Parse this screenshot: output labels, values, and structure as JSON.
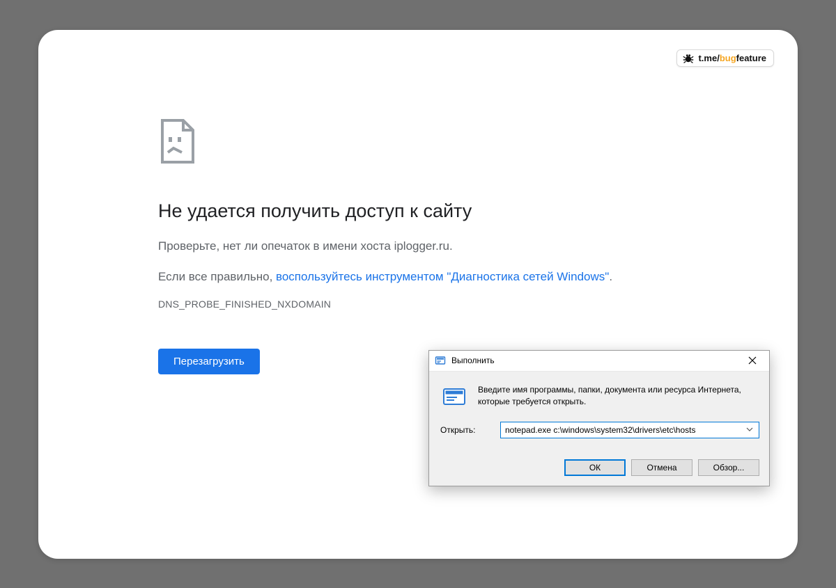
{
  "badge": {
    "prefix": "t.me/",
    "highlight": "bug",
    "suffix": "feature"
  },
  "error": {
    "title": "Не удается получить доступ к сайту",
    "line1": "Проверьте, нет ли опечаток в имени хоста iplogger.ru.",
    "line2_prefix": "Если все правильно, ",
    "line2_link": "воспользуйтесь инструментом \"Диагностика сетей Windows\"",
    "line2_suffix": ".",
    "code": "DNS_PROBE_FINISHED_NXDOMAIN",
    "reload": "Перезагрузить"
  },
  "run": {
    "title": "Выполнить",
    "description": "Введите имя программы, папки, документа или ресурса Интернета, которые требуется открыть.",
    "open_label": "Открыть:",
    "command": "notepad.exe c:\\windows\\system32\\drivers\\etc\\hosts",
    "ok": "ОК",
    "cancel": "Отмена",
    "browse": "Обзор..."
  }
}
